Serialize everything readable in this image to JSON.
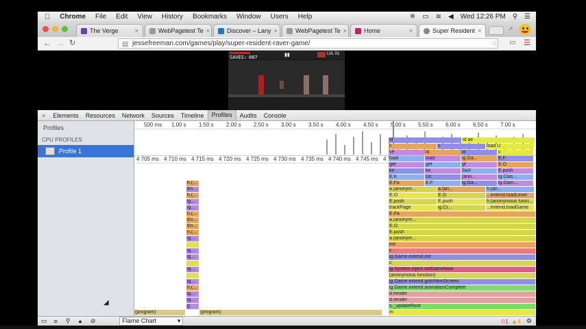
{
  "menubar": {
    "apple": "",
    "app": "Chrome",
    "items": [
      "File",
      "Edit",
      "View",
      "History",
      "Bookmarks",
      "Window",
      "Users",
      "Help"
    ],
    "clock": "Wed 12:26 PM"
  },
  "tabs": [
    {
      "label": "The Verge",
      "color": "#6a3fb0"
    },
    {
      "label": "WebPagetest Te",
      "color": "#999"
    },
    {
      "label": "Discover – Lany",
      "color": "#1e78c8"
    },
    {
      "label": "WebPagetest Te",
      "color": "#999"
    },
    {
      "label": "Home",
      "color": "#c0226a"
    },
    {
      "label": "Super Resident",
      "color": "#888"
    }
  ],
  "address": {
    "url": "jessefreeman.com/games/play/super-resident-raver-game/"
  },
  "game": {
    "saves_label": "SAVES:",
    "saves_value": "007",
    "lvl": "LVL 01"
  },
  "devtools": {
    "tabs": [
      "Elements",
      "Resources",
      "Network",
      "Sources",
      "Timeline",
      "Profiles",
      "Audits",
      "Console"
    ],
    "selected_tab": "Profiles",
    "sidebar": {
      "heading": "Profiles",
      "section": "CPU PROFILES",
      "profile": "Profile 1"
    },
    "overview_ticks": [
      "500 ms",
      "1.00 s",
      "1.50 s",
      "2.00 s",
      "2.50 s",
      "3.00 s",
      "3.50 s",
      "4.00 s",
      "4.50 s",
      "5.00 s",
      "5.50 s",
      "6.00 s",
      "6.50 s",
      "7.00 s"
    ],
    "detail_ticks": [
      "4 705 ms",
      "4 710 ms",
      "4 715 ms",
      "4 720 ms",
      "4 725 ms",
      "4 730 ms",
      "4 735 ms",
      "4 740 ms",
      "4 745 ms",
      "4 750 ms",
      "4 755 ms",
      "4 760 ms"
    ],
    "flame_left_labels": [
      "h.(...",
      "En...",
      "h.(...",
      "ig...",
      "ig...",
      "h.(...",
      "En...",
      "En...",
      "h.(...",
      "ig...",
      "",
      "ig...",
      "ig...",
      "",
      "ig...",
      "",
      "ig...",
      "h.(...",
      "ig...",
      "ig...",
      "g"
    ],
    "bottom_program": [
      "(program)",
      "(program)"
    ],
    "stack": [
      "m",
      "s._updateRoot",
      "d.render",
      "d.render",
      "ig.Game.extend.animationComplete",
      "ig.Game.extend.gotoNextScreen",
      "(anonymous function)",
      "ig.System.inject.setGameNow",
      "c",
      "ig.Game.extend.init",
      "c",
      "init",
      "a.(anonym...",
      "E.push",
      "E.O",
      "a.(anonym...",
      "E.Fa"
    ],
    "mid_stack": [
      [
        "trackPage",
        "ig.Cl...",
        "...extend.loadGame"
      ],
      [
        "E.push",
        "E.push",
        "h.(anonymous funct..."
      ],
      [
        "E.O",
        "E.O",
        "...extend.loadLevel"
      ],
      [
        "a.(anonym...",
        "a.(an...",
        "h.(an..."
      ],
      [
        "E.Fa",
        "E.F",
        "ig.Ga...",
        "ig.Gam..."
      ],
      [
        "E.K",
        "Uc",
        "(ano...",
        "ig.Clas..."
      ],
      [
        "ke",
        "ke",
        "SaX",
        "E.push"
      ],
      [
        "get",
        "get",
        "gf",
        "E.O"
      ],
      [
        "load",
        "load",
        "ig.Ga...",
        "E.F"
      ],
      [
        "ve",
        "id",
        "id",
        "c"
      ],
      [
        "c",
        "c",
        "load U"
      ],
      [
        "id",
        "id ae"
      ]
    ],
    "statusbar": {
      "mode": "Flame Chart",
      "errors": "1",
      "warnings": "4"
    }
  }
}
